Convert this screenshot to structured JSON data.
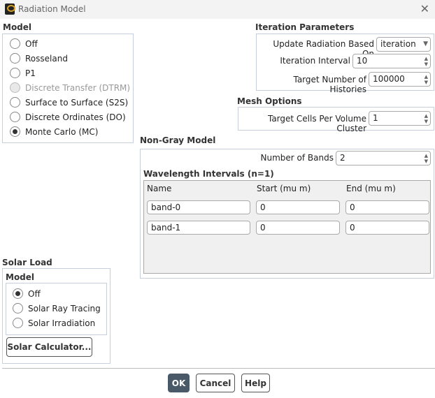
{
  "window": {
    "title": "Radiation Model",
    "icon": "fluent-app-icon",
    "close_icon": "close-icon"
  },
  "model": {
    "header": "Model",
    "options": [
      {
        "label": "Off",
        "selected": false,
        "enabled": true
      },
      {
        "label": "Rosseland",
        "selected": false,
        "enabled": true
      },
      {
        "label": "P1",
        "selected": false,
        "enabled": true
      },
      {
        "label": "Discrete Transfer (DTRM)",
        "selected": false,
        "enabled": false
      },
      {
        "label": "Surface to Surface (S2S)",
        "selected": false,
        "enabled": true
      },
      {
        "label": "Discrete Ordinates (DO)",
        "selected": false,
        "enabled": true
      },
      {
        "label": "Monte Carlo (MC)",
        "selected": true,
        "enabled": true
      }
    ]
  },
  "iteration": {
    "header": "Iteration Parameters",
    "update_label": "Update Radiation Based On",
    "update_value": "iteration",
    "interval_label": "Iteration Interval",
    "interval_value": "10",
    "histories_label": "Target Number of Histories",
    "histories_value": "100000"
  },
  "mesh": {
    "header": "Mesh Options",
    "cells_label": "Target Cells Per Volume Cluster",
    "cells_value": "1"
  },
  "nongray": {
    "header": "Non-Gray Model",
    "bands_label": "Number of Bands",
    "bands_value": "2",
    "intervals_header": "Wavelength Intervals (n=1)",
    "columns": [
      "Name",
      "Start (mu m)",
      "End (mu m)"
    ],
    "rows": [
      {
        "name": "band-0",
        "start": "0",
        "end": "0"
      },
      {
        "name": "band-1",
        "start": "0",
        "end": "0"
      }
    ]
  },
  "solar": {
    "header": "Solar Load",
    "model_header": "Model",
    "options": [
      {
        "label": "Off",
        "selected": true
      },
      {
        "label": "Solar Ray Tracing",
        "selected": false
      },
      {
        "label": "Solar Irradiation",
        "selected": false
      }
    ],
    "calculator_label": "Solar Calculator..."
  },
  "buttons": {
    "ok": "OK",
    "cancel": "Cancel",
    "help": "Help"
  }
}
